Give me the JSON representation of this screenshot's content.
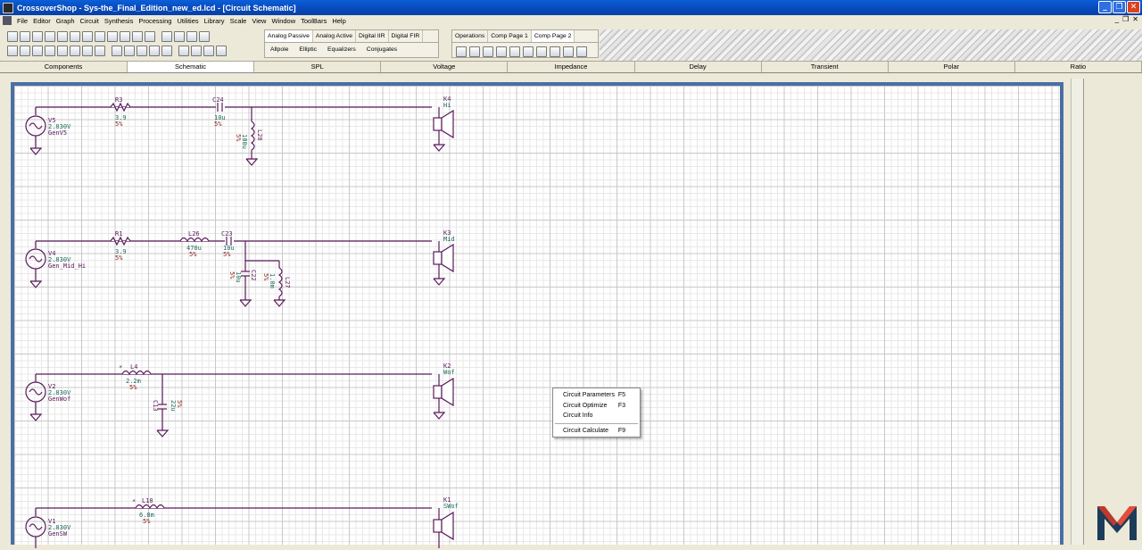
{
  "window": {
    "title": "CrossoverShop - Sys-the_Final_Edition_new_ed.lcd - [Circuit Schematic]"
  },
  "menu": [
    "File",
    "Editor",
    "Graph",
    "Circuit",
    "Synthesis",
    "Processing",
    "Utilities",
    "Library",
    "Scale",
    "View",
    "Window",
    "ToolBars",
    "Help"
  ],
  "toolbar_group_1": {
    "tabs": [
      "Analog Passive",
      "Analog Active",
      "Digital IIR",
      "Digital FIR"
    ],
    "active_tab": "Analog Passive",
    "items": [
      "Allpole",
      "Elliptic",
      "Equalizers",
      "Conjugates"
    ]
  },
  "toolbar_group_2": {
    "tabs": [
      "Operations",
      "Comp Page 1",
      "Comp Page 2"
    ],
    "active_tab": "Comp Page 2"
  },
  "view_tabs": [
    "Components",
    "Schematic",
    "SPL",
    "Voltage",
    "Impedance",
    "Delay",
    "Transient",
    "Polar",
    "Ratio"
  ],
  "active_view_tab": "Schematic",
  "context_menu": [
    {
      "label": "Circuit Parameters",
      "shortcut": "F5"
    },
    {
      "label": "Circuit Optimize",
      "shortcut": "F3"
    },
    {
      "label": "Circuit Info",
      "shortcut": ""
    },
    {
      "label": "Circuit Calculate",
      "shortcut": "F9"
    }
  ],
  "schematic": {
    "sources": [
      {
        "ref": "V5",
        "voltage": "2.830V",
        "name": "GenV5"
      },
      {
        "ref": "V4",
        "voltage": "2.830V",
        "name": "Gen_Mid_Hi"
      },
      {
        "ref": "V2",
        "voltage": "2.830V",
        "name": "GenWof"
      },
      {
        "ref": "V1",
        "voltage": "2.830V",
        "name": "GenSW"
      }
    ],
    "speakers": [
      {
        "ref": "K4",
        "name": "Hi"
      },
      {
        "ref": "K3",
        "name": "Mid"
      },
      {
        "ref": "K2",
        "name": "Wof"
      },
      {
        "ref": "K1",
        "name": "SWof"
      }
    ],
    "components": {
      "R3": {
        "ref": "R3",
        "value": "3.9",
        "tol": "5%"
      },
      "C24": {
        "ref": "C24",
        "value": "10u",
        "tol": "5%"
      },
      "L28": {
        "ref": "L28",
        "value": "100u",
        "tol": "5%"
      },
      "R1": {
        "ref": "R1",
        "value": "3.9",
        "tol": "5%"
      },
      "L26": {
        "ref": "L26",
        "value": "470u",
        "tol": "5%"
      },
      "C23": {
        "ref": "C23",
        "value": "10u",
        "tol": "5%"
      },
      "C22": {
        "ref": "C22",
        "value": "10u",
        "tol": "5%"
      },
      "L27": {
        "ref": "L27",
        "value": "1.0m",
        "tol": "5%"
      },
      "L4": {
        "ref": "L4",
        "value": "2.2m",
        "tol": "5%"
      },
      "C13": {
        "ref": "C13",
        "value": "22u",
        "tol": "5%"
      },
      "L18": {
        "ref": "L18",
        "value": "6.8m",
        "tol": "5%"
      }
    }
  }
}
